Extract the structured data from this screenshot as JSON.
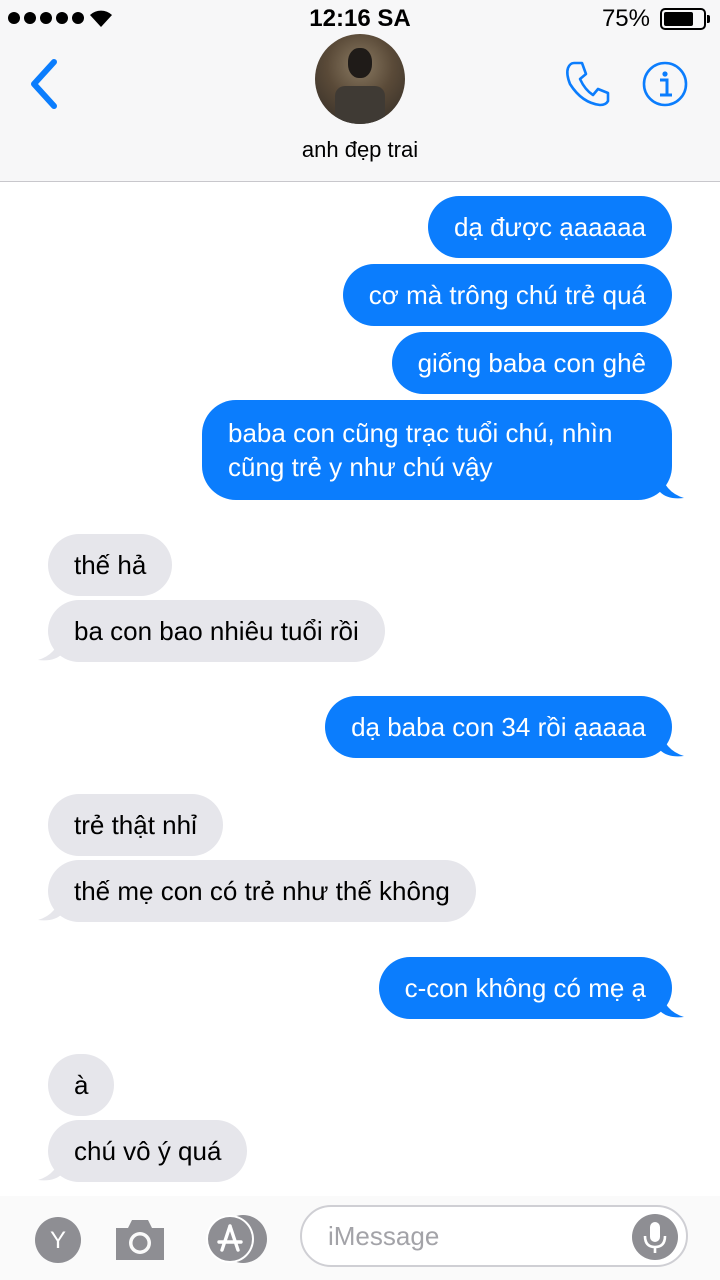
{
  "status_bar": {
    "time": "12:16 SA",
    "battery_percent": "75%",
    "battery_level": 0.75,
    "signal_bars": 5
  },
  "header": {
    "contact_name": "anh đẹp trai",
    "back_icon": "chevron-left-icon",
    "phone_icon": "phone-icon",
    "info_icon": "info-icon"
  },
  "messages": [
    {
      "from": "me",
      "text": "dạ được ạaaaaa"
    },
    {
      "from": "me",
      "text": "cơ mà trông chú trẻ quá"
    },
    {
      "from": "me",
      "text": "giống baba con ghê"
    },
    {
      "from": "me",
      "text": "baba con cũng trạc tuổi chú, nhìn cũng trẻ y như chú vậy"
    },
    {
      "from": "them",
      "text": "thế hả"
    },
    {
      "from": "them",
      "text": "ba con bao nhiêu tuổi rồi"
    },
    {
      "from": "me",
      "text": "dạ baba con 34 rồi ạaaaa"
    },
    {
      "from": "them",
      "text": "trẻ thật nhỉ"
    },
    {
      "from": "them",
      "text": "thế mẹ con có trẻ như thế không"
    },
    {
      "from": "me",
      "text": "c-con không có mẹ ạ"
    },
    {
      "from": "them",
      "text": "à"
    },
    {
      "from": "them",
      "text": "chú vô ý quá"
    }
  ],
  "input_bar": {
    "placeholder": "iMessage",
    "apps_letter": "Y",
    "icons": [
      "apps-icon",
      "camera-icon",
      "app-store-icon",
      "microphone-icon"
    ]
  },
  "colors": {
    "outgoing_bubble": "#0b7dfd",
    "incoming_bubble": "#e6e6eb",
    "accent": "#0b7dfd"
  }
}
